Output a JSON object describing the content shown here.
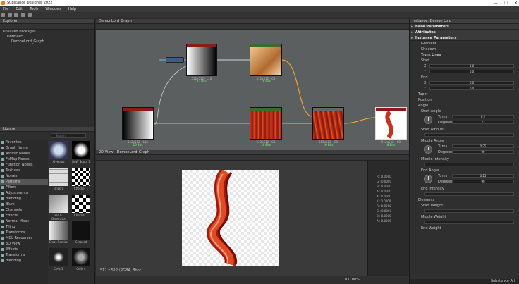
{
  "window": {
    "title": "Substance Designer 2022"
  },
  "menu": [
    "File",
    "Edit",
    "Tools",
    "Windows",
    "Help"
  ],
  "explorer": {
    "title": "Explorer",
    "rows": [
      "Unsaved Packages",
      "Untitled*",
      "DemonLord_Graph"
    ]
  },
  "library": {
    "title": "Library",
    "search_placeholder": "Search",
    "categories": [
      "Favorites",
      "Graph Items",
      "Atomic Nodes",
      "FxMap Nodes",
      "Function Nodes",
      "Textures",
      "Noises",
      "Patterns",
      "Filters",
      "Adjustments",
      "Blending",
      "Blurs",
      "Channels",
      "Effects",
      "Normal Maps",
      "Tiling",
      "Transforms",
      "MDL Resources",
      "3D View",
      "Effects",
      "Transforms",
      "Blending"
    ],
    "selected": "Patterns",
    "items": [
      "Alveolus",
      "BnW Spots 1",
      "Brick 1",
      "Checker 1",
      "BRDF Generator",
      "Checker 1",
      "Cross Section",
      "Creased",
      "Cells 1",
      "Cells 4"
    ]
  },
  "graph": {
    "title": "DemonLord_Graph",
    "nodes": [
      {
        "id": "gradient_linear",
        "title": "Gradient Linear 1",
        "size": "512x512 - L16",
        "label": "12 Bits"
      },
      {
        "id": "gradient_map",
        "title": "Gradient Map",
        "size": "512x512 - C8",
        "label": "16 Bits"
      },
      {
        "id": "linear_gradient",
        "title": "Linear Gradient",
        "size": "512x512 - L16",
        "label": "16 Bits"
      },
      {
        "id": "gradient_map_2",
        "title": "Gradient Map",
        "size": "512x512 - C8",
        "label": "16 Bits"
      },
      {
        "id": "warp",
        "title": "Warp",
        "size": "512x512 - C8",
        "label": "16 Bits"
      },
      {
        "id": "output",
        "title": "Demon Lord",
        "size": "512x512 - C8",
        "label": "8 Bits"
      }
    ]
  },
  "view2d": {
    "title": "2D View - DemonLord_Graph",
    "status": "512 x 512 (RGBA, 8bpc)",
    "zoom": "100.00%"
  },
  "info": {
    "rows": [
      "R : 0.0000",
      "G : 0.0000",
      "B : 0.0000",
      "A : 0.0000",
      "X : 0.0000",
      "Y : 0.0000",
      "R : 0.0000",
      "G : 0.0000",
      "B : 0.0000",
      "A : 0.0000"
    ]
  },
  "props": {
    "title": "Instance: Demon Lord",
    "sections": [
      "Base Parameters",
      "Attributes",
      "Instance Parameters"
    ],
    "subsections": [
      "Gradient",
      "Shadows",
      "Trunk Lines"
    ],
    "start_label": "Start",
    "x_val": "0.0",
    "y_val": "0.0",
    "end_label": "End",
    "x2": "0.0",
    "y2": "0.0",
    "taper": "Taper",
    "position": "Position",
    "angle": "Angle",
    "start_angle": "Start Angle",
    "turns_val": "0.2",
    "degrees_val": "72",
    "start_amount": "Start Amount",
    "middle_angle": "Middle Angle",
    "turns2": "0.25",
    "degrees2": "90",
    "middle_intensity": "Middle Intensity",
    "end_angle": "End Angle",
    "turns3": "0.25",
    "degrees3": "90",
    "end_intensity": "End Intensity",
    "elements": "Elements",
    "start_weight": "Start Weight",
    "middle_weight": "Middle Weight",
    "end_weight": "End Weight",
    "turns_label": "Turns",
    "degrees_label": "Degrees",
    "footer": "Substance Art"
  }
}
